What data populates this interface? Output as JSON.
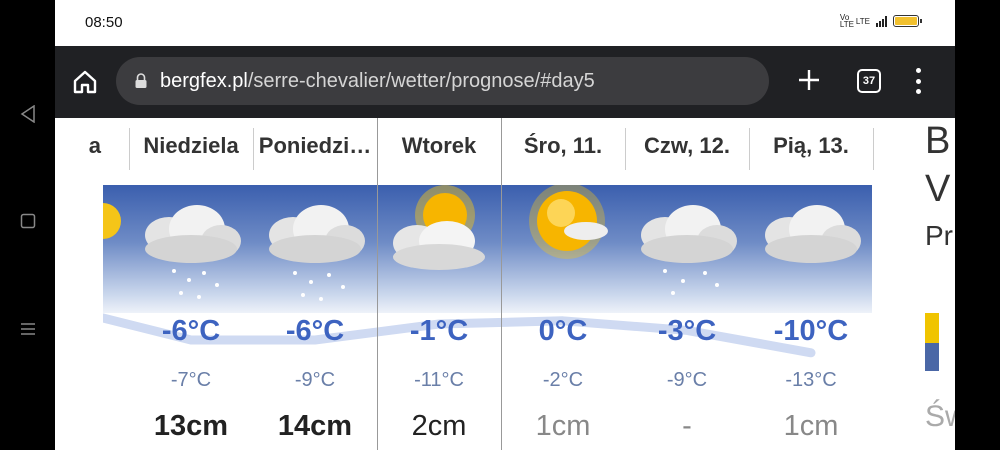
{
  "status": {
    "time": "08:50",
    "volte": "Vo LTE",
    "lte": "LTE",
    "battery_level": 1.0,
    "battery_color": "#f2c12e"
  },
  "browser": {
    "url_host": "bergfex.pl",
    "url_path": "/serre-chevalier/wetter/prognose/#day5",
    "tab_count": "37"
  },
  "forecast": {
    "partial_left_day": "a",
    "days": [
      {
        "label": "Niedziela",
        "icon": "cloud-snow-icon",
        "tmax": "-6°C",
        "tmin": "-7°C",
        "snow": "13cm"
      },
      {
        "label": "Poniedzi…",
        "icon": "cloud-snow-icon",
        "tmax": "-6°C",
        "tmin": "-9°C",
        "snow": "14cm"
      },
      {
        "label": "Wtorek",
        "icon": "sun-cloud-icon",
        "tmax": "-1°C",
        "tmin": "-11°C",
        "snow": "2cm"
      },
      {
        "label": "Śro, 11.",
        "icon": "sun-icon",
        "tmax": "0°C",
        "tmin": "-2°C",
        "snow": "1cm"
      },
      {
        "label": "Czw, 12.",
        "icon": "cloud-snow-icon",
        "tmax": "-3°C",
        "tmin": "-9°C",
        "snow": "-"
      },
      {
        "label": "Pią, 13.",
        "icon": "cloud-icon",
        "tmax": "-10°C",
        "tmin": "-13°C",
        "snow": "1cm"
      }
    ],
    "max_temps": [
      -6,
      -6,
      -1,
      0,
      -3,
      -10
    ],
    "accent_color": "#3d63c0"
  },
  "side_panel": {
    "letters": [
      "B",
      "V",
      "Pr",
      "Św"
    ]
  }
}
